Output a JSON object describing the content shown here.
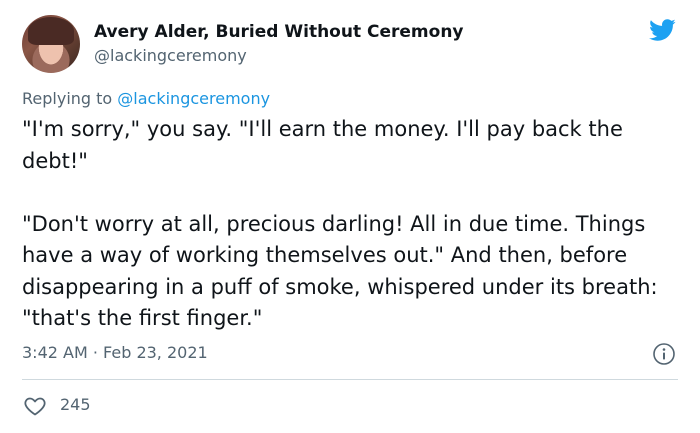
{
  "author": {
    "display_name": "Avery Alder, Buried Without Ceremony",
    "handle": "@lackingceremony",
    "avatar_icon": "profile-photo"
  },
  "reply": {
    "prefix": "Replying to",
    "mention": "@lackingceremony"
  },
  "tweet": {
    "paragraphs": [
      "\"I'm sorry,\" you say. \"I'll earn the money. I'll pay back the debt!\"",
      "\"Don't worry at all, precious darling! All in due time. Things have a way of working themselves out.\" And then, before disappearing in a puff of smoke, whispered under its breath: \"that's the first finger.\""
    ]
  },
  "meta": {
    "timestamp": "3:42 AM · Feb 23, 2021"
  },
  "actions": {
    "likes": "245"
  },
  "icons": {
    "brand": "twitter-bird-icon",
    "info": "info-icon",
    "like": "heart-icon"
  },
  "colors": {
    "brand_blue": "#1da1f2",
    "link_blue": "#1b95e0",
    "secondary_text": "#536471",
    "divider": "#cfd9de"
  }
}
